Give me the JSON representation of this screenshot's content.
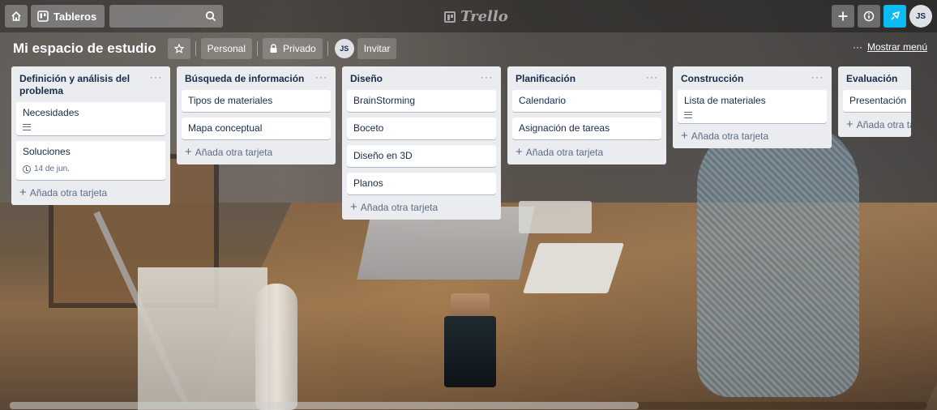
{
  "topbar": {
    "home_icon": "home-icon",
    "boards_label": "Tableros",
    "search_icon": "search-icon",
    "logo_text": "Trello",
    "add_icon": "plus-icon",
    "info_icon": "info-icon",
    "notify_icon": "bell-icon",
    "user_initials": "JS"
  },
  "board": {
    "title": "Mi espacio de estudio",
    "team": "Personal",
    "visibility": "Privado",
    "member_initials": "JS",
    "invite_label": "Invitar",
    "menu_dots": "···",
    "show_menu": "Mostrar menú"
  },
  "add_card_label": "Añada otra tarjeta",
  "lists": [
    {
      "title": "Definición y análisis del problema",
      "cards": [
        {
          "title": "Necesidades",
          "has_description": true
        },
        {
          "title": "Soluciones",
          "due": "14 de jun."
        }
      ]
    },
    {
      "title": "Búsqueda de información",
      "cards": [
        {
          "title": "Tipos de materiales"
        },
        {
          "title": "Mapa conceptual"
        }
      ]
    },
    {
      "title": "Diseño",
      "cards": [
        {
          "title": "BrainStorming"
        },
        {
          "title": "Boceto"
        },
        {
          "title": "Diseño en 3D"
        },
        {
          "title": "Planos"
        }
      ]
    },
    {
      "title": "Planificación",
      "cards": [
        {
          "title": "Calendario"
        },
        {
          "title": "Asignación de tareas"
        }
      ]
    },
    {
      "title": "Construcción",
      "cards": [
        {
          "title": "Lista de materiales",
          "has_description": true
        }
      ]
    },
    {
      "title": "Evaluación",
      "cards": [
        {
          "title": "Presentación"
        }
      ]
    }
  ],
  "list_menu": "···",
  "colors": {
    "accent_notify": "#0bbcf2",
    "list_bg": "#ebecf0",
    "text": "#172b4d"
  }
}
